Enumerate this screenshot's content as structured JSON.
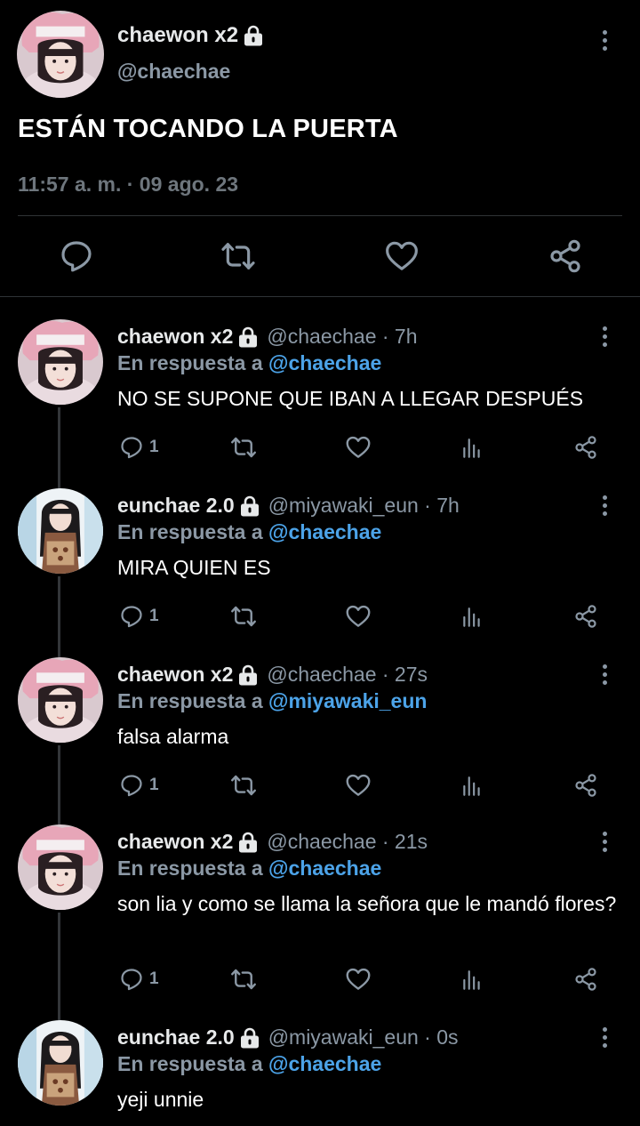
{
  "main_tweet": {
    "name": "chaewon x2",
    "handle": "@chaechae",
    "text": "ESTÁN TOCANDO LA PUERTA",
    "timestamp": "11:57 a. m. · 09 ago. 23",
    "actions": [
      "reply-icon",
      "retweet-icon",
      "like-icon",
      "share-icon"
    ]
  },
  "replies": [
    {
      "name": "chaewon x2",
      "handle": "@chaechae · 7h",
      "reply_prefix": "En respuesta a",
      "reply_to": "@chaechae",
      "text": "NO SE SUPONE QUE IBAN A LLEGAR DESPUÉS",
      "reply_count": "1",
      "avatar": "pink-hood-avatar"
    },
    {
      "name": "eunchae 2.0",
      "handle": "@miyawaki_eun · 7h",
      "reply_prefix": "En respuesta a",
      "reply_to": "@chaechae",
      "text": "MIRA QUIEN ES",
      "reply_count": "1",
      "avatar": "dark-hair-avatar"
    },
    {
      "name": "chaewon x2",
      "handle": "@chaechae · 27s",
      "reply_prefix": "En respuesta a",
      "reply_to": "@miyawaki_eun",
      "text": "falsa alarma",
      "reply_count": "1",
      "avatar": "pink-hood-avatar"
    },
    {
      "name": "chaewon x2",
      "handle": "@chaechae · 21s",
      "reply_prefix": "En respuesta a",
      "reply_to": "@chaechae",
      "text": "son lia y como se llama la señora que le mandó flores?",
      "reply_count": "1",
      "avatar": "pink-hood-avatar"
    },
    {
      "name": "eunchae 2.0",
      "handle": "@miyawaki_eun · 0s",
      "reply_prefix": "En respuesta a",
      "reply_to": "@chaechae",
      "text": "yeji unnie",
      "reply_count": "",
      "avatar": "dark-hair-avatar"
    }
  ],
  "colors": {
    "background": "#000000",
    "text": "#e7e9ea",
    "muted": "#8b98a5",
    "link": "#4ca3e8",
    "divider": "#2f3336"
  }
}
